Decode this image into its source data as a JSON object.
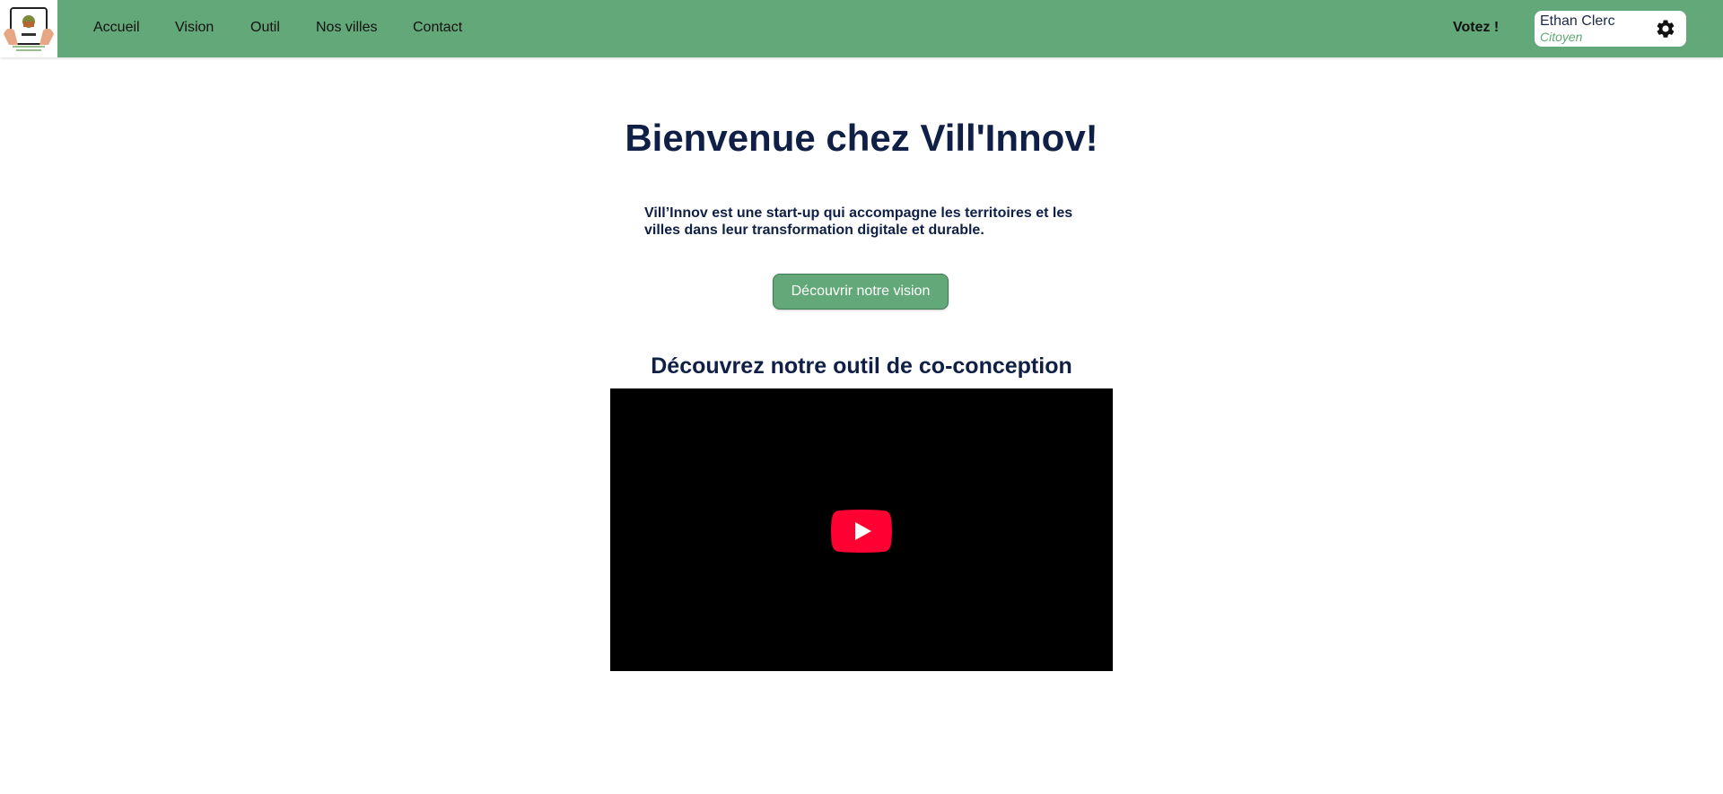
{
  "colors": {
    "nav_background": "#63a878",
    "title_text": "#0f1f45",
    "accent": "#63a878",
    "youtube_red": "#ff0033"
  },
  "header": {
    "logo_icon": "vill-innov-logo",
    "nav_items": [
      "Accueil",
      "Vision",
      "Outil",
      "Nos villes",
      "Contact"
    ],
    "vote_label": "Votez !",
    "user": {
      "name": "Ethan Clerc",
      "role": "Citoyen",
      "settings_icon": "gear-icon"
    }
  },
  "hero": {
    "title": "Bienvenue chez Vill'Innov!",
    "description": "Vill’Innov est une start-up qui accompagne les territoires et les villes dans leur transformation digitale et durable.",
    "cta_label": "Découvrir notre vision"
  },
  "video_section": {
    "title": "Découvrez notre outil de co-conception",
    "player_icon": "youtube-play-icon"
  }
}
